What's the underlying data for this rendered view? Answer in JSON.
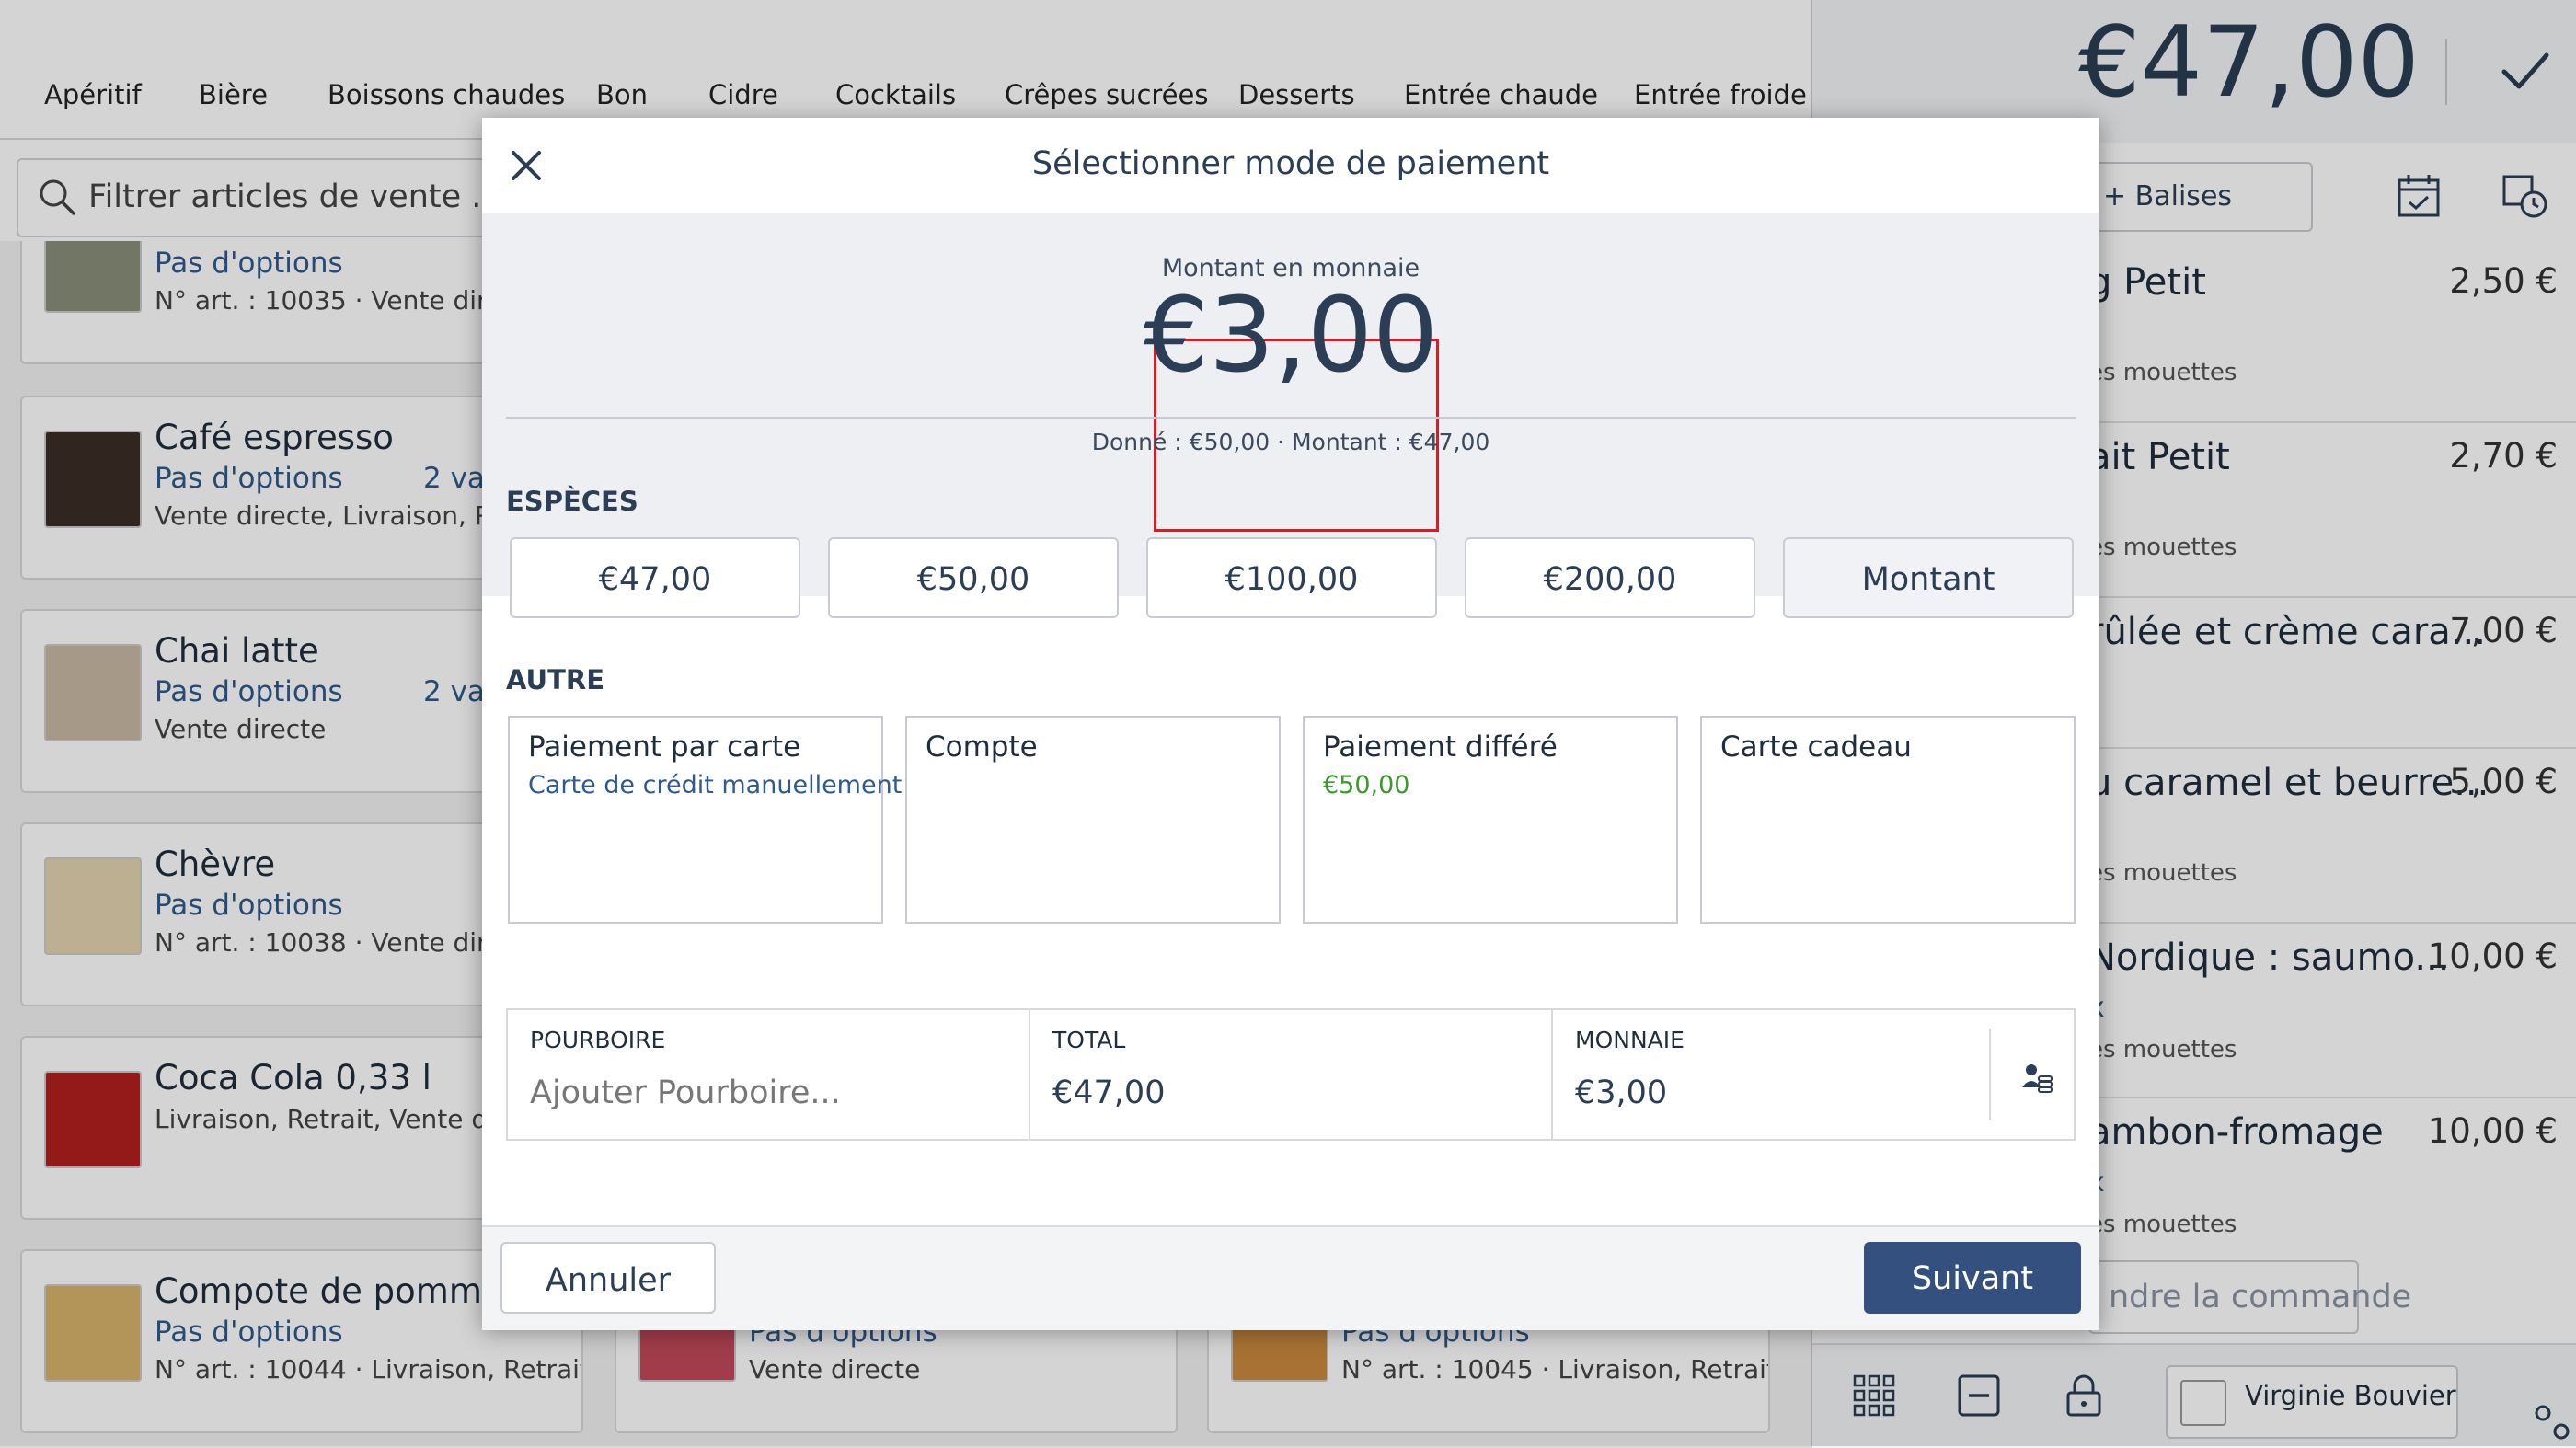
{
  "categories": [
    "Apéritif",
    "Bière",
    "Boissons chaudes",
    "Bon",
    "Cidre",
    "Cocktails",
    "Crêpes sucrées",
    "Desserts",
    "Entrée chaude",
    "Entrée froide"
  ],
  "search": {
    "placeholder": "Filtrer articles de vente ..."
  },
  "products": [
    {
      "name": "",
      "options": "Pas d'options",
      "variants": "",
      "meta": "N° art. : 10035 · Vente directe"
    },
    {
      "name": "Café espresso",
      "options": "Pas d'options",
      "variants": "2 var",
      "meta": "Vente directe, Livraison, Retrait"
    },
    {
      "name": "Chai latte",
      "options": "Pas d'options",
      "variants": "2 var",
      "meta": "Vente directe"
    },
    {
      "name": "Chèvre",
      "options": "Pas d'options",
      "variants": "",
      "meta": "N° art. : 10038 · Vente directe"
    },
    {
      "name": "Coca Cola 0,33 l",
      "options": "",
      "variants": "",
      "meta": "Livraison, Retrait, Vente directe"
    },
    {
      "name": "Compote de pommes",
      "options": "Pas d'options",
      "variants": "",
      "meta": "N° art. : 10044 · Livraison, Retrait..."
    },
    {
      "name": "",
      "options": "Pas d'options",
      "variants": "",
      "meta": "Vente directe"
    },
    {
      "name": "",
      "options": "Pas d'options",
      "variants": "",
      "meta": "N° art. : 10045 · Livraison, Retrait..."
    }
  ],
  "order": {
    "total": "€47,00",
    "tags_label": "+ Balises",
    "items": [
      {
        "name": "g Petit",
        "price": "2,50 €",
        "sub": "es mouettes",
        "extra": ""
      },
      {
        "name": "ait Petit",
        "price": "2,70 €",
        "sub": "es mouettes",
        "extra": ""
      },
      {
        "name": "rûlée et crème cara...",
        "price": "7,00 €",
        "sub": "",
        "extra": ""
      },
      {
        "name": "u caramel et beurre...",
        "price": "5,00 €",
        "sub": "es mouettes",
        "extra": ""
      },
      {
        "name": "Nordique : saumo...",
        "price": "10,00 €",
        "sub": "es mouettes",
        "extra": "x"
      },
      {
        "name": "ambon-fromage",
        "price": "10,00 €",
        "sub": "es mouettes",
        "extra": "x"
      }
    ],
    "send_label": "ndre la commande",
    "user": "Virginie Bouvier"
  },
  "modal": {
    "title": "Sélectionner mode de paiement",
    "change_label": "Montant en monnaie",
    "change_value": "€3,00",
    "change_detail": "Donné : €50,00 · Montant : €47,00",
    "cash_section": "ESPÈCES",
    "cash_buttons": [
      "€47,00",
      "€50,00",
      "€100,00",
      "€200,00",
      "Montant"
    ],
    "other_section": "AUTRE",
    "other_methods": [
      {
        "title": "Paiement par carte",
        "sub": "Carte de crédit manuellement",
        "sub_color": "#2e5a8c"
      },
      {
        "title": "Compte",
        "sub": "",
        "sub_color": "#2e5a8c"
      },
      {
        "title": "Paiement différé",
        "sub": "€50,00",
        "sub_color": "#3a9a2e"
      },
      {
        "title": "Carte cadeau",
        "sub": "",
        "sub_color": "#2e5a8c"
      }
    ],
    "tip_label": "POURBOIRE",
    "tip_placeholder": "Ajouter Pourboire...",
    "total_label": "TOTAL",
    "total_value": "€47,00",
    "change_field_label": "MONNAIE",
    "change_field_value": "€3,00",
    "cancel_label": "Annuler",
    "next_label": "Suivant"
  },
  "colors": {
    "accent": "#34507f",
    "highlight": "#e0181f",
    "link": "#2e5a8c",
    "success": "#3a9a2e"
  }
}
